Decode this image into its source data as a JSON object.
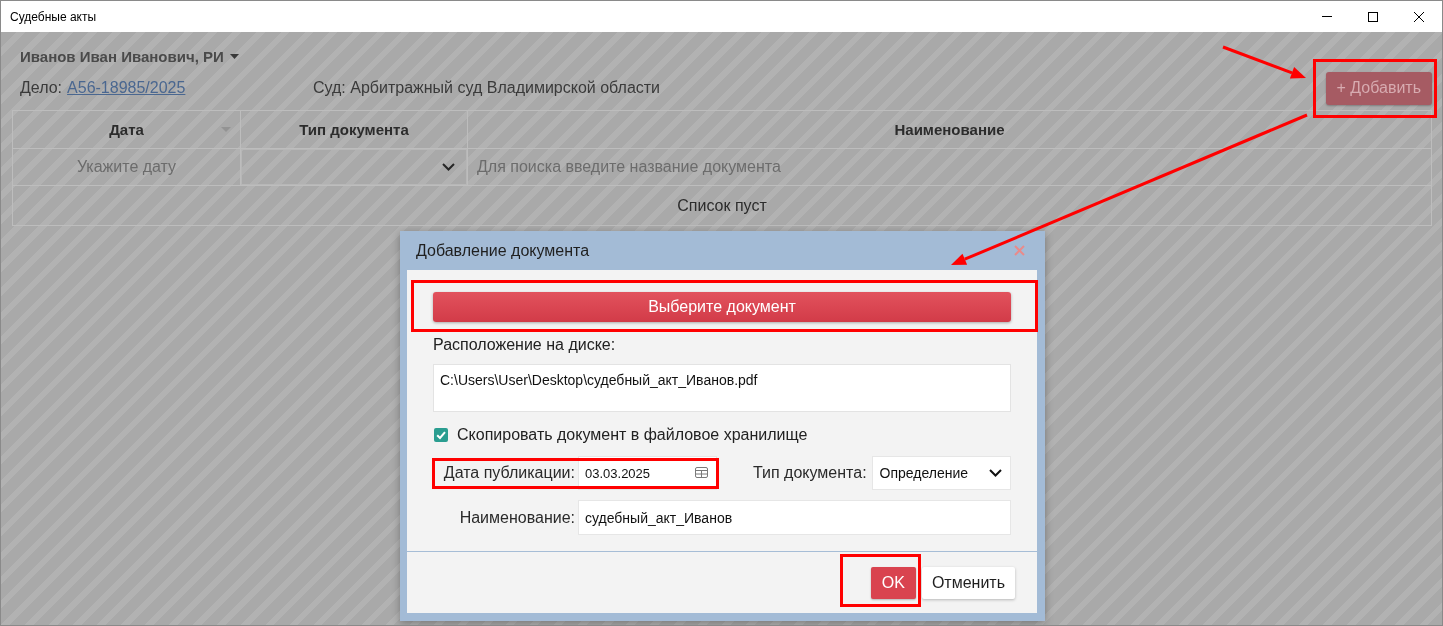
{
  "window": {
    "title": "Судебные акты"
  },
  "header": {
    "user": "Иванов Иван Иванович, РИ",
    "case_label": "Дело:",
    "case_number": "А56-18985/2025",
    "court": "Суд: Арбитражный суд Владимирской области",
    "add_button": {
      "label": "+ Добавить",
      "highlighted": true
    }
  },
  "table": {
    "columns": [
      {
        "label": "Дата",
        "sorted": true
      },
      {
        "label": "Тип документа",
        "sorted": false
      },
      {
        "label": "Наименование",
        "sorted": false
      }
    ],
    "filters": {
      "date_placeholder": "Укажите дату",
      "name_placeholder": "Для поиска введите название документа"
    },
    "empty_text": "Список пуст"
  },
  "dialog": {
    "title": "Добавление документа",
    "choose_button": {
      "label": "Выберите документ",
      "highlighted": true
    },
    "location": {
      "label": "Расположение на диске:",
      "value": "C:\\Users\\User\\Desktop\\судебный_акт_Иванов.pdf"
    },
    "copy_to_storage": {
      "label": "Скопировать документ в файловое хранилище",
      "checked": true
    },
    "publication_date": {
      "label": "Дата публикации:",
      "value": "03.03.2025",
      "highlighted": true
    },
    "document_type": {
      "label": "Тип документа:",
      "value": "Определение"
    },
    "document_name": {
      "label": "Наименование:",
      "value": "судебный_акт_Иванов"
    },
    "buttons": [
      {
        "label": "OK",
        "kind": "primary",
        "highlighted": true
      },
      {
        "label": "Отменить",
        "kind": "secondary",
        "highlighted": false
      }
    ]
  }
}
